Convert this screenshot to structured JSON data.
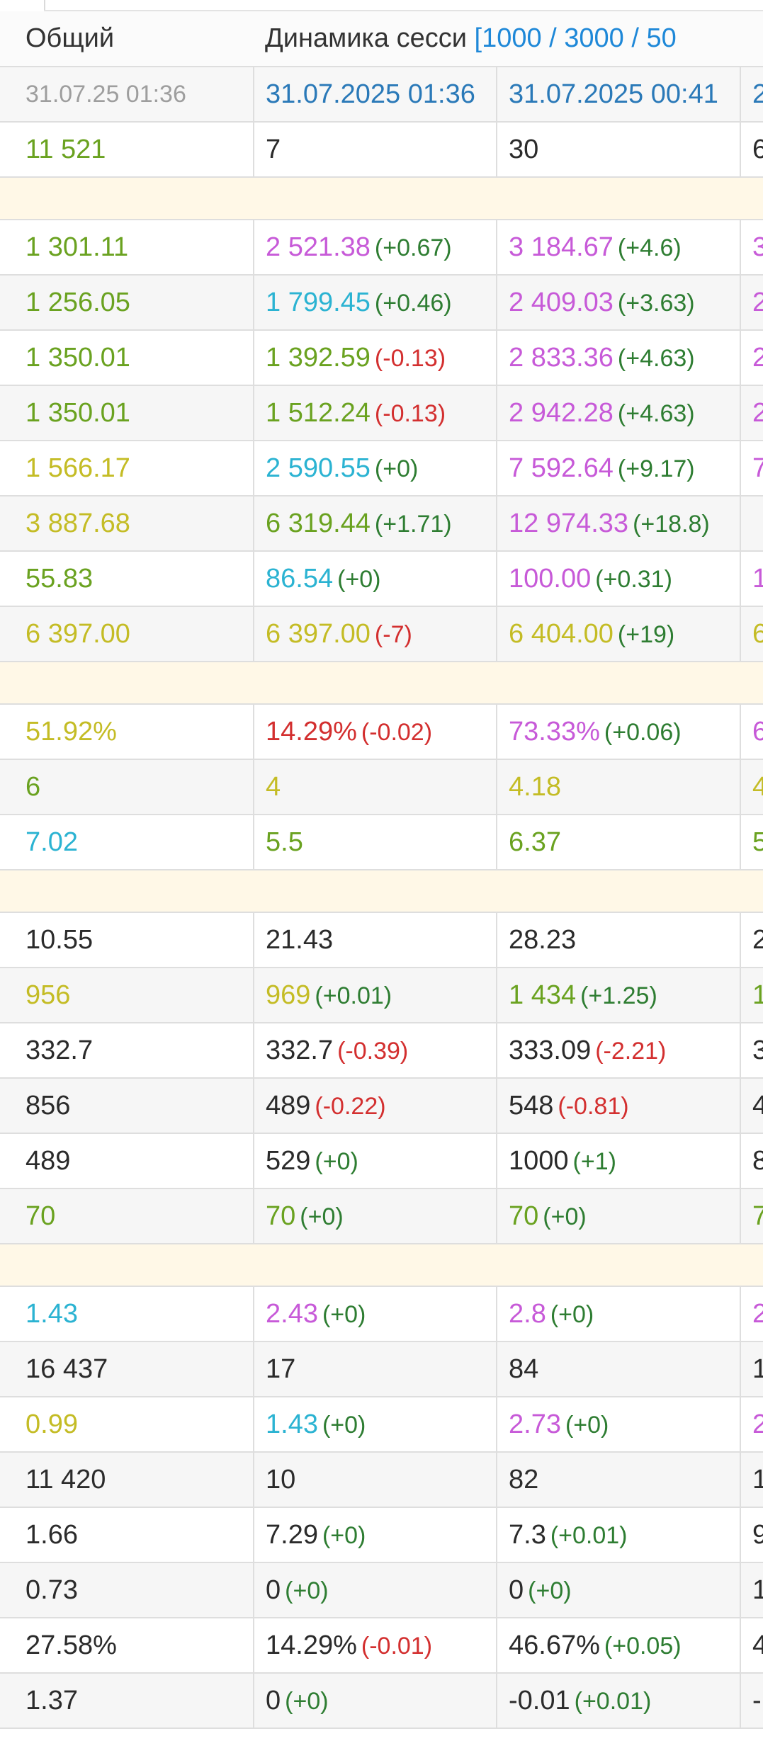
{
  "header": {
    "col0_title": "Общий",
    "col1_title": "Динамика сесси",
    "col1_range": "[1000 / 3000 / 50",
    "col3_title": ""
  },
  "dates": {
    "total": "31.07.25 01:36",
    "s1": "31.07.2025 01:36",
    "s2": "31.07.2025 00:41",
    "s3": "2"
  },
  "colors": {
    "green": "#6aa220",
    "delta_positive": "#2e7d32",
    "delta_negative": "#d32f2f",
    "purple": "#c75ad8",
    "cyan": "#2bb3d2",
    "yellow": "#c4bc25",
    "separator": "#fff8e7"
  },
  "rows": [
    {
      "kind": "row",
      "cells": [
        {
          "v": "11 521",
          "c": "green"
        },
        {
          "v": "7",
          "c": "dark"
        },
        {
          "v": "30",
          "c": "dark"
        },
        {
          "v": "6",
          "c": "dark"
        }
      ]
    },
    {
      "kind": "sep"
    },
    {
      "kind": "row",
      "cells": [
        {
          "v": "1 301.11",
          "c": "green"
        },
        {
          "v": "2 521.38",
          "c": "purple",
          "d": "(+0.67)",
          "dc": "dgreen"
        },
        {
          "v": "3 184.67",
          "c": "purple",
          "d": "(+4.6)",
          "dc": "dgreen"
        },
        {
          "v": "3",
          "c": "purple"
        }
      ]
    },
    {
      "kind": "row",
      "cells": [
        {
          "v": "1 256.05",
          "c": "green"
        },
        {
          "v": "1 799.45",
          "c": "cyan",
          "d": "(+0.46)",
          "dc": "dgreen"
        },
        {
          "v": "2 409.03",
          "c": "purple",
          "d": "(+3.63)",
          "dc": "dgreen"
        },
        {
          "v": "2",
          "c": "purple"
        }
      ]
    },
    {
      "kind": "row",
      "cells": [
        {
          "v": "1 350.01",
          "c": "green"
        },
        {
          "v": "1 392.59",
          "c": "green",
          "d": "(-0.13)",
          "dc": "red"
        },
        {
          "v": "2 833.36",
          "c": "purple",
          "d": "(+4.63)",
          "dc": "dgreen"
        },
        {
          "v": "2",
          "c": "purple"
        }
      ]
    },
    {
      "kind": "row",
      "cells": [
        {
          "v": "1 350.01",
          "c": "green"
        },
        {
          "v": "1 512.24",
          "c": "green",
          "d": "(-0.13)",
          "dc": "red"
        },
        {
          "v": "2 942.28",
          "c": "purple",
          "d": "(+4.63)",
          "dc": "dgreen"
        },
        {
          "v": "2",
          "c": "purple"
        }
      ]
    },
    {
      "kind": "row",
      "cells": [
        {
          "v": "1 566.17",
          "c": "yellow"
        },
        {
          "v": "2 590.55",
          "c": "cyan",
          "d": "(+0)",
          "dc": "dgreen"
        },
        {
          "v": "7 592.64",
          "c": "purple",
          "d": "(+9.17)",
          "dc": "dgreen"
        },
        {
          "v": "7",
          "c": "purple"
        }
      ]
    },
    {
      "kind": "row",
      "cells": [
        {
          "v": "3 887.68",
          "c": "yellow"
        },
        {
          "v": "6 319.44",
          "c": "green",
          "d": "(+1.71)",
          "dc": "dgreen"
        },
        {
          "v": "12 974.33",
          "c": "purple",
          "d": "(+18.8)",
          "dc": "dgreen"
        },
        {
          "v": "",
          "c": "purple"
        }
      ]
    },
    {
      "kind": "row",
      "cells": [
        {
          "v": "55.83",
          "c": "green"
        },
        {
          "v": "86.54",
          "c": "cyan",
          "d": "(+0)",
          "dc": "dgreen"
        },
        {
          "v": "100.00",
          "c": "purple",
          "d": "(+0.31)",
          "dc": "dgreen"
        },
        {
          "v": "1",
          "c": "purple"
        }
      ]
    },
    {
      "kind": "row",
      "cells": [
        {
          "v": "6 397.00",
          "c": "yellow"
        },
        {
          "v": "6 397.00",
          "c": "yellow",
          "d": "(-7)",
          "dc": "red"
        },
        {
          "v": "6 404.00",
          "c": "yellow",
          "d": "(+19)",
          "dc": "dgreen"
        },
        {
          "v": "6",
          "c": "yellow"
        }
      ]
    },
    {
      "kind": "sep"
    },
    {
      "kind": "row",
      "cells": [
        {
          "v": "51.92%",
          "c": "yellow"
        },
        {
          "v": "14.29%",
          "c": "red",
          "d": "(-0.02)",
          "dc": "red"
        },
        {
          "v": "73.33%",
          "c": "purple",
          "d": "(+0.06)",
          "dc": "dgreen"
        },
        {
          "v": "6",
          "c": "purple"
        }
      ]
    },
    {
      "kind": "row",
      "cells": [
        {
          "v": "6",
          "c": "green"
        },
        {
          "v": "4",
          "c": "yellow"
        },
        {
          "v": "4.18",
          "c": "yellow"
        },
        {
          "v": "4",
          "c": "yellow"
        }
      ]
    },
    {
      "kind": "row",
      "cells": [
        {
          "v": "7.02",
          "c": "cyan"
        },
        {
          "v": "5.5",
          "c": "green"
        },
        {
          "v": "6.37",
          "c": "green"
        },
        {
          "v": "5",
          "c": "green"
        }
      ]
    },
    {
      "kind": "sep"
    },
    {
      "kind": "row",
      "cells": [
        {
          "v": "10.55",
          "c": "dark"
        },
        {
          "v": "21.43",
          "c": "dark"
        },
        {
          "v": "28.23",
          "c": "dark"
        },
        {
          "v": "2",
          "c": "dark"
        }
      ]
    },
    {
      "kind": "row",
      "cells": [
        {
          "v": "956",
          "c": "yellow"
        },
        {
          "v": "969",
          "c": "yellow",
          "d": "(+0.01)",
          "dc": "dgreen"
        },
        {
          "v": "1 434",
          "c": "green",
          "d": "(+1.25)",
          "dc": "dgreen"
        },
        {
          "v": "1",
          "c": "green"
        }
      ]
    },
    {
      "kind": "row",
      "cells": [
        {
          "v": "332.7",
          "c": "dark"
        },
        {
          "v": "332.7",
          "c": "dark",
          "d": "(-0.39)",
          "dc": "red"
        },
        {
          "v": "333.09",
          "c": "dark",
          "d": "(-2.21)",
          "dc": "red"
        },
        {
          "v": "3",
          "c": "dark"
        }
      ]
    },
    {
      "kind": "row",
      "cells": [
        {
          "v": "856",
          "c": "dark"
        },
        {
          "v": "489",
          "c": "dark",
          "d": "(-0.22)",
          "dc": "red"
        },
        {
          "v": "548",
          "c": "dark",
          "d": "(-0.81)",
          "dc": "red"
        },
        {
          "v": "4",
          "c": "dark"
        }
      ]
    },
    {
      "kind": "row",
      "cells": [
        {
          "v": "489",
          "c": "dark"
        },
        {
          "v": "529",
          "c": "dark",
          "d": "(+0)",
          "dc": "dgreen"
        },
        {
          "v": "1000",
          "c": "dark",
          "d": "(+1)",
          "dc": "dgreen"
        },
        {
          "v": "8",
          "c": "dark"
        }
      ]
    },
    {
      "kind": "row",
      "cells": [
        {
          "v": "70",
          "c": "green"
        },
        {
          "v": "70",
          "c": "green",
          "d": "(+0)",
          "dc": "dgreen"
        },
        {
          "v": "70",
          "c": "green",
          "d": "(+0)",
          "dc": "dgreen"
        },
        {
          "v": "7",
          "c": "green"
        }
      ]
    },
    {
      "kind": "sep"
    },
    {
      "kind": "row",
      "cells": [
        {
          "v": "1.43",
          "c": "cyan"
        },
        {
          "v": "2.43",
          "c": "purple",
          "d": "(+0)",
          "dc": "dgreen"
        },
        {
          "v": "2.8",
          "c": "purple",
          "d": "(+0)",
          "dc": "dgreen"
        },
        {
          "v": "2",
          "c": "purple"
        }
      ]
    },
    {
      "kind": "row",
      "cells": [
        {
          "v": "16 437",
          "c": "dark"
        },
        {
          "v": "17",
          "c": "dark"
        },
        {
          "v": "84",
          "c": "dark"
        },
        {
          "v": "1",
          "c": "dark"
        }
      ]
    },
    {
      "kind": "row",
      "cells": [
        {
          "v": "0.99",
          "c": "yellow"
        },
        {
          "v": "1.43",
          "c": "cyan",
          "d": "(+0)",
          "dc": "dgreen"
        },
        {
          "v": "2.73",
          "c": "purple",
          "d": "(+0)",
          "dc": "dgreen"
        },
        {
          "v": "2",
          "c": "purple"
        }
      ]
    },
    {
      "kind": "row",
      "cells": [
        {
          "v": "11 420",
          "c": "dark"
        },
        {
          "v": "10",
          "c": "dark"
        },
        {
          "v": "82",
          "c": "dark"
        },
        {
          "v": "1",
          "c": "dark"
        }
      ]
    },
    {
      "kind": "row",
      "cells": [
        {
          "v": "1.66",
          "c": "dark"
        },
        {
          "v": "7.29",
          "c": "dark",
          "d": "(+0)",
          "dc": "dgreen"
        },
        {
          "v": "7.3",
          "c": "dark",
          "d": "(+0.01)",
          "dc": "dgreen"
        },
        {
          "v": "9",
          "c": "dark"
        }
      ]
    },
    {
      "kind": "row",
      "cells": [
        {
          "v": "0.73",
          "c": "dark"
        },
        {
          "v": "0",
          "c": "dark",
          "d": "(+0)",
          "dc": "dgreen"
        },
        {
          "v": "0",
          "c": "dark",
          "d": "(+0)",
          "dc": "dgreen"
        },
        {
          "v": "1",
          "c": "dark"
        }
      ]
    },
    {
      "kind": "row",
      "cells": [
        {
          "v": "27.58%",
          "c": "dark"
        },
        {
          "v": "14.29%",
          "c": "dark",
          "d": "(-0.01)",
          "dc": "red"
        },
        {
          "v": "46.67%",
          "c": "dark",
          "d": "(+0.05)",
          "dc": "dgreen"
        },
        {
          "v": "4",
          "c": "dark"
        }
      ]
    },
    {
      "kind": "row",
      "cells": [
        {
          "v": "1.37",
          "c": "dark"
        },
        {
          "v": "0",
          "c": "dark",
          "d": "(+0)",
          "dc": "dgreen"
        },
        {
          "v": "-0.01",
          "c": "dark",
          "d": "(+0.01)",
          "dc": "dgreen"
        },
        {
          "v": "-(",
          "c": "dark"
        }
      ]
    }
  ]
}
